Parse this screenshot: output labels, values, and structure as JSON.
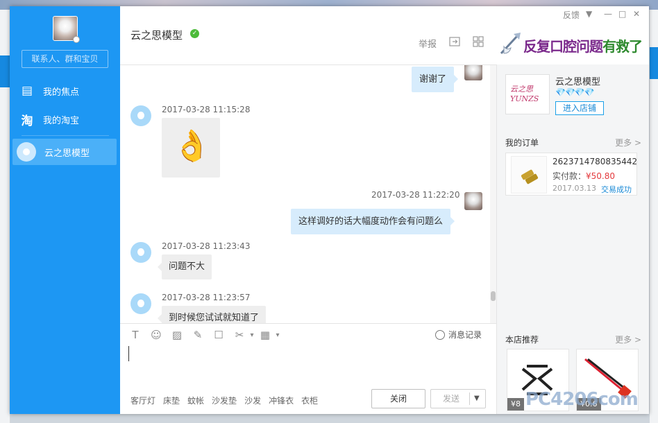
{
  "window_controls": {
    "feedback_label": "反馈",
    "dropdown_glyph": "▼",
    "minimize_glyph": "—",
    "maximize_glyph": "□",
    "close_glyph": "✕"
  },
  "sidebar": {
    "search_placeholder": "联系人、群和宝贝",
    "items": [
      {
        "label": "我的焦点",
        "icon": "focus-icon",
        "glyph": "▤"
      },
      {
        "label": "我的淘宝",
        "icon": "taobao-icon",
        "glyph": "淘"
      },
      {
        "label": "云之思模型",
        "icon": "bot-avatar-icon",
        "active": true
      }
    ]
  },
  "chat": {
    "title": "云之思模型",
    "verified_glyph": "✓",
    "report_label": "举报",
    "messages": [
      {
        "side": "right",
        "text": "谢谢了"
      },
      {
        "side": "left",
        "time": "2017-03-28 11:15:28",
        "sticker": "👌"
      },
      {
        "side": "right",
        "time": "2017-03-28 11:22:20",
        "text": "这样调好的话大幅度动作会有问题么"
      },
      {
        "side": "left",
        "time": "2017-03-28 11:23:43",
        "text": "问题不大"
      },
      {
        "side": "left",
        "time": "2017-03-28 11:23:57",
        "text": "到时候您试试就知道了"
      }
    ]
  },
  "ad": {
    "text_purple": "反复口腔问题",
    "text_green": "有救了"
  },
  "toolbar": {
    "font_glyph": "T",
    "emoji_glyph": "☺",
    "image_glyph": "▨",
    "screenshot_glyph": "✎",
    "quick_reply_glyph": "☐",
    "cut_glyph": "✂",
    "more_glyph": "▦",
    "dropdown_glyph": "▾",
    "history_label": "消息记录"
  },
  "footer": {
    "tags": [
      "客厅灯",
      "床垫",
      "蚊帐",
      "沙发垫",
      "沙发",
      "冲锋衣",
      "衣柜"
    ],
    "close_label": "关闭",
    "send_label": "发送",
    "send_dropdown_glyph": "▼"
  },
  "store": {
    "name": "云之思模型",
    "logo_line1": "云之思",
    "logo_line2": "YUNZS",
    "diamonds": "💎💎💎💎",
    "enter_label": "进入店铺"
  },
  "orders": {
    "title": "我的订单",
    "more_label": "更多 >",
    "items": [
      {
        "order_no": "2623714780835442",
        "paid_label": "实付款：",
        "amount": "¥50.80",
        "date": "2017.03.13",
        "status": "交易成功"
      }
    ]
  },
  "recommend": {
    "title": "本店推荐",
    "more_label": "更多 >",
    "products": [
      {
        "price": "¥8"
      },
      {
        "price": "¥0.6"
      }
    ]
  },
  "watermark": "PC4206com"
}
